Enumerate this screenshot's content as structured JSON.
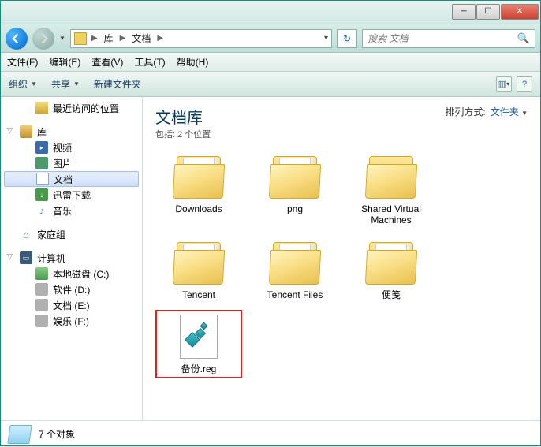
{
  "titlebar": {
    "min": "─",
    "max": "☐",
    "close": "✕"
  },
  "nav": {
    "crumbs": [
      "库",
      "文档"
    ],
    "refresh": "↻"
  },
  "search": {
    "placeholder": "搜索 文档",
    "icon": "🔍"
  },
  "menubar": {
    "file": "文件(F)",
    "edit": "编辑(E)",
    "view": "查看(V)",
    "tools": "工具(T)",
    "help": "帮助(H)"
  },
  "toolbar": {
    "organize": "组织",
    "share": "共享",
    "newfolder": "新建文件夹"
  },
  "sidebar": {
    "recent": "最近访问的位置",
    "libraries": "库",
    "videos": "视频",
    "pictures": "图片",
    "documents": "文档",
    "xunlei": "迅雷下载",
    "music": "音乐",
    "homegroup": "家庭组",
    "computer": "计算机",
    "drive_c": "本地磁盘 (C:)",
    "drive_d": "软件 (D:)",
    "drive_e": "文档 (E:)",
    "drive_f": "娱乐 (F:)"
  },
  "content": {
    "title": "文档库",
    "subtitle": "包括: 2 个位置",
    "sort_label": "排列方式:",
    "sort_value": "文件夹",
    "items": [
      {
        "name": "Downloads",
        "type": "folder-gear"
      },
      {
        "name": "png",
        "type": "folder-paper"
      },
      {
        "name": "Shared Virtual Machines",
        "type": "folder"
      },
      {
        "name": "Tencent",
        "type": "folder-paper"
      },
      {
        "name": "Tencent Files",
        "type": "folder-paper"
      },
      {
        "name": "便笺",
        "type": "folder-paper"
      },
      {
        "name": "备份.reg",
        "type": "reg",
        "highlight": true
      }
    ]
  },
  "status": {
    "text": "7 个对象"
  }
}
